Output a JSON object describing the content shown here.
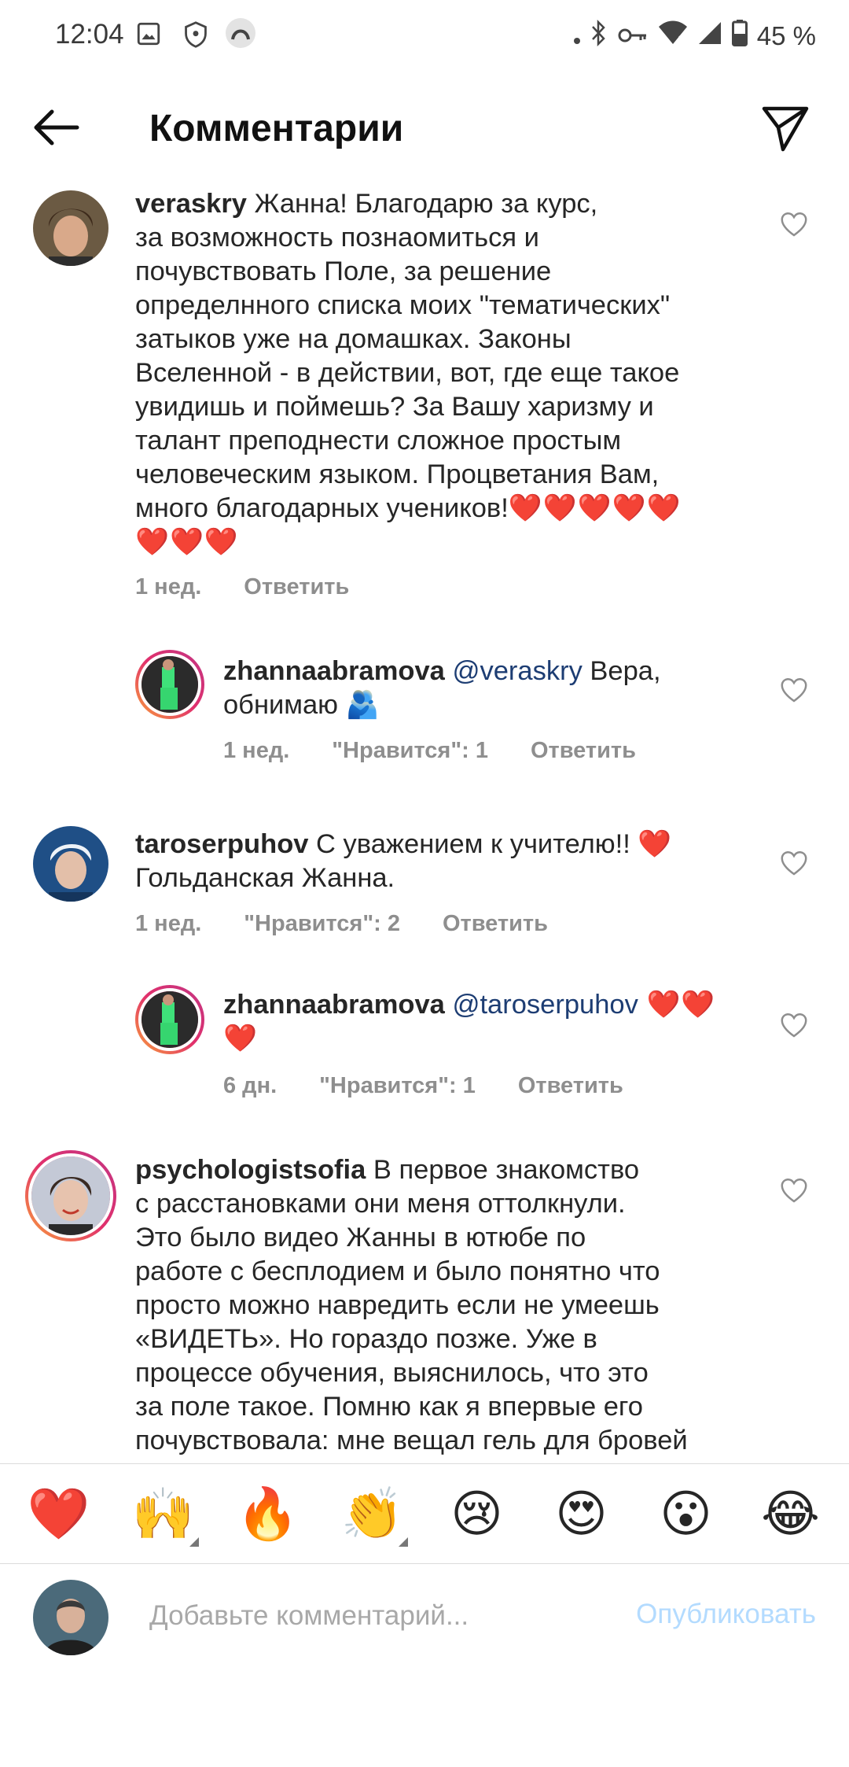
{
  "status_bar": {
    "time": "12:04",
    "battery": "45 %",
    "icons": [
      "image-icon",
      "shield-icon",
      "app-icon",
      "dot-icon",
      "bluetooth-icon",
      "key-icon",
      "wifi-icon",
      "signal-icon",
      "battery-icon"
    ]
  },
  "header": {
    "title": "Комментарии"
  },
  "comments": [
    {
      "username": "veraskry",
      "text": "Жанна! Благодарю за курс,\nза возможность познаомиться и\nпочувствовать Поле, за решение\nопределнного списка моих \"тематических\"\nзатыков уже на домашках. Законы\nВселенной - в действии, вот, где еще такое\nувидишь и поймешь? За Вашу харизму и\nталант преподнести сложное простым\nчеловеческим языком. Процветания Вам,\nмного благодарных учеников!",
      "hearts_inline": "❤️❤️❤️❤️❤️",
      "hearts_next": "❤️❤️❤️",
      "time": "1 нед.",
      "reply": "Ответить"
    },
    {
      "username": "zhannaabramova",
      "mention": "@veraskry",
      "text": " Вера,\nобнимаю 🫂",
      "time": "1 нед.",
      "likes": "\"Нравится\": 1",
      "reply": "Ответить"
    },
    {
      "username": "taroserpuhov",
      "text": " С уважением к учителю!! ❤️\nГольданская Жанна.",
      "time": "1 нед.",
      "likes": "\"Нравится\": 2",
      "reply": "Ответить"
    },
    {
      "username": "zhannaabramova",
      "mention": "@taroserpuhov",
      "text": " ❤️❤️\n❤️",
      "time": "6 дн.",
      "likes": "\"Нравится\": 1",
      "reply": "Ответить"
    },
    {
      "username": "psychologistsofia",
      "text": " В первое знакомство\nс расстановками они меня оттолкнули.\nЭто было видео Жанны в ютюбе по\nработе с бесплодием и было понятно что\nпросто можно навредить если не умеешь\n«ВИДЕТЬ». Но гораздо позже. Уже в\nпроцессе обучения, выяснилось, что это\nза поле такое. Помню как я впервые его\nпочувствовала: мне вещал гель для бровей"
    }
  ],
  "emoji_bar": [
    "❤️",
    "🙌",
    "🔥",
    "👏",
    "😢",
    "😍",
    "😮",
    "😂"
  ],
  "input": {
    "placeholder": "Добавьте комментарий...",
    "publish_label": "Опубликовать"
  },
  "colors": {
    "heart_red": "#e8112d",
    "mention_blue": "#1d3d73",
    "meta_gray": "#8e8e8e",
    "publish_disabled": "#b3dbff"
  }
}
